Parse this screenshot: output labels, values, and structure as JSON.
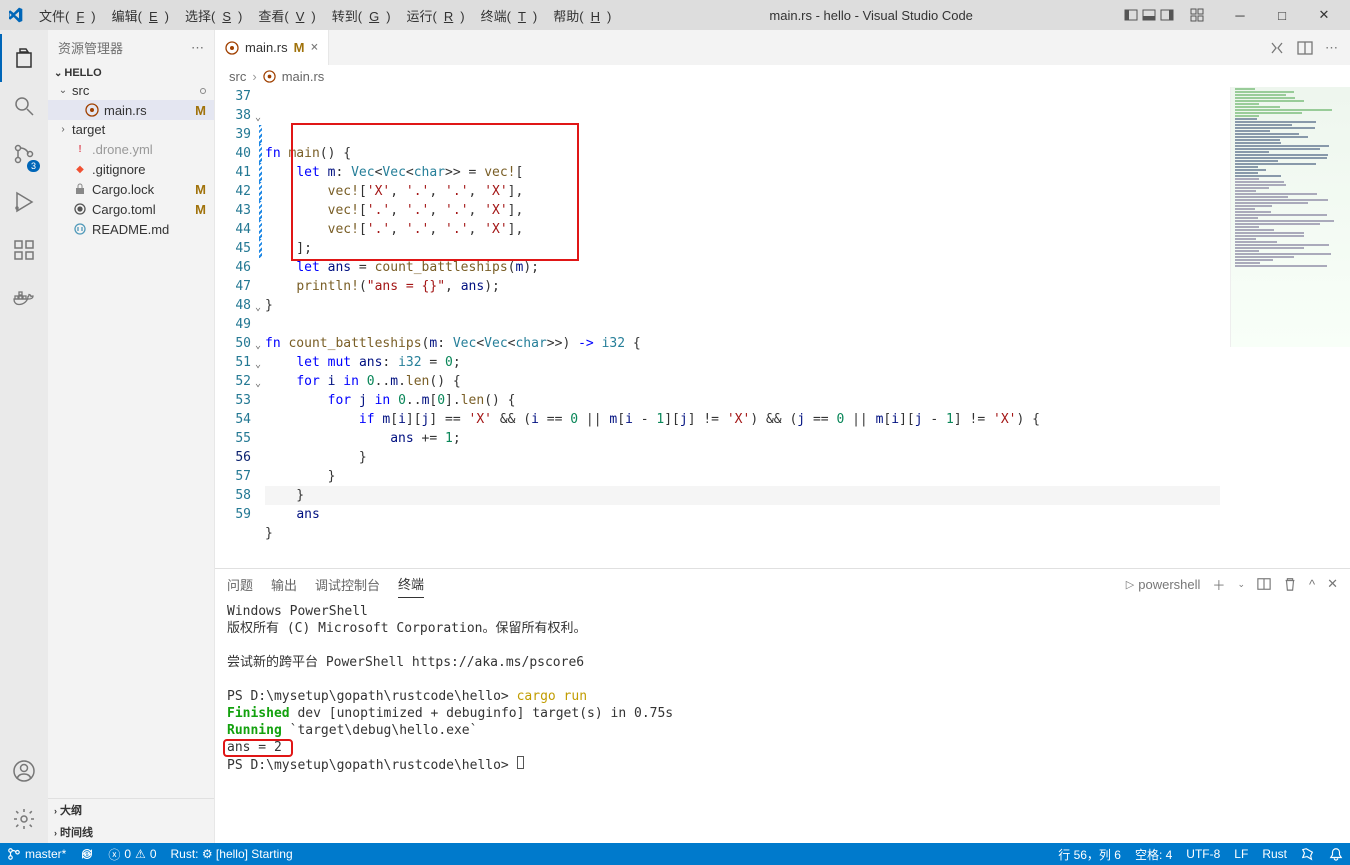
{
  "title": "main.rs - hello - Visual Studio Code",
  "menu": [
    "文件(F)",
    "编辑(E)",
    "选择(S)",
    "查看(V)",
    "转到(G)",
    "运行(R)",
    "终端(T)",
    "帮助(H)"
  ],
  "sidebar": {
    "header": "资源管理器",
    "section": "HELLO",
    "items": [
      {
        "name": "src",
        "kind": "folder",
        "open": true,
        "depth": 0,
        "dirty": true
      },
      {
        "name": "main.rs",
        "kind": "rust",
        "depth": 1,
        "mark": "M",
        "sel": true
      },
      {
        "name": "target",
        "kind": "folder",
        "open": false,
        "depth": 0
      },
      {
        "name": ".drone.yml",
        "kind": "yml",
        "depth": 0,
        "mute": true
      },
      {
        "name": ".gitignore",
        "kind": "git",
        "depth": 0
      },
      {
        "name": "Cargo.lock",
        "kind": "lock",
        "depth": 0,
        "mark": "M"
      },
      {
        "name": "Cargo.toml",
        "kind": "toml",
        "depth": 0,
        "mark": "M"
      },
      {
        "name": "README.md",
        "kind": "md",
        "depth": 0
      }
    ],
    "footer": [
      "大纲",
      "时间线"
    ]
  },
  "tab": {
    "name": "main.rs",
    "mark": "M"
  },
  "breadcrumbs": [
    "src",
    "main.rs"
  ],
  "code": {
    "start": 37,
    "current": 56,
    "lines": [
      {
        "html": ""
      },
      {
        "html": "<span class='k-blue'>fn</span> <span class='k-fn'>main</span>() {",
        "chev": true
      },
      {
        "html": "    <span class='k-blue'>let</span> <span class='k-var'>m</span>: <span class='k-teal'>Vec</span>&lt;<span class='k-teal'>Vec</span>&lt;<span class='k-teal'>char</span>&gt;&gt; = <span class='k-fn'>vec!</span>[",
        "mod": true
      },
      {
        "html": "        <span class='k-fn'>vec!</span>[<span class='k-red'>'X'</span>, <span class='k-red'>'.'</span>, <span class='k-red'>'.'</span>, <span class='k-red'>'X'</span>],",
        "mod": true
      },
      {
        "html": "        <span class='k-fn'>vec!</span>[<span class='k-red'>'.'</span>, <span class='k-red'>'.'</span>, <span class='k-red'>'.'</span>, <span class='k-red'>'X'</span>],",
        "mod": true
      },
      {
        "html": "        <span class='k-fn'>vec!</span>[<span class='k-red'>'.'</span>, <span class='k-red'>'.'</span>, <span class='k-red'>'.'</span>, <span class='k-red'>'X'</span>],",
        "mod": true
      },
      {
        "html": "    ];",
        "mod": true
      },
      {
        "html": "    <span class='k-blue'>let</span> <span class='k-var'>ans</span> = <span class='k-fn'>count_battleships</span>(<span class='k-var'>m</span>);",
        "mod": true
      },
      {
        "html": "    <span class='k-fn'>println!</span>(<span class='k-red'>\"ans = {}\"</span>, <span class='k-var'>ans</span>);",
        "mod": true
      },
      {
        "html": "}"
      },
      {
        "html": ""
      },
      {
        "html": "<span class='k-blue'>fn</span> <span class='k-fn'>count_battleships</span>(<span class='k-var'>m</span>: <span class='k-teal'>Vec</span>&lt;<span class='k-teal'>Vec</span>&lt;<span class='k-teal'>char</span>&gt;&gt;) <span class='k-blue'>-&gt;</span> <span class='k-teal'>i32</span> {",
        "chev": true
      },
      {
        "html": "    <span class='k-blue'>let</span> <span class='k-blue'>mut</span> <span class='k-var'>ans</span>: <span class='k-teal'>i32</span> = <span class='k-num'>0</span>;"
      },
      {
        "html": "    <span class='k-blue'>for</span> <span class='k-var'>i</span> <span class='k-blue'>in</span> <span class='k-num'>0</span>..<span class='k-var'>m</span>.<span class='k-fn'>len</span>() {",
        "chev": true
      },
      {
        "html": "        <span class='k-blue'>for</span> <span class='k-var'>j</span> <span class='k-blue'>in</span> <span class='k-num'>0</span>..<span class='k-var'>m</span>[<span class='k-num'>0</span>].<span class='k-fn'>len</span>() {",
        "chev": true
      },
      {
        "html": "            <span class='k-blue'>if</span> <span class='k-var'>m</span>[<span class='k-var'>i</span>][<span class='k-var'>j</span>] == <span class='k-red'>'X'</span> &amp;&amp; (<span class='k-var'>i</span> == <span class='k-num'>0</span> || <span class='k-var'>m</span>[<span class='k-var'>i</span> - <span class='k-num'>1</span>][<span class='k-var'>j</span>] != <span class='k-red'>'X'</span>) &amp;&amp; (<span class='k-var'>j</span> == <span class='k-num'>0</span> || <span class='k-var'>m</span>[<span class='k-var'>i</span>][<span class='k-var'>j</span> - <span class='k-num'>1</span>] != <span class='k-red'>'X'</span>) {",
        "chev": true
      },
      {
        "html": "                <span class='k-var'>ans</span> += <span class='k-num'>1</span>;"
      },
      {
        "html": "            }"
      },
      {
        "html": "        }"
      },
      {
        "html": "    }",
        "hl": true
      },
      {
        "html": "    <span class='k-var'>ans</span>"
      },
      {
        "html": "}"
      },
      {
        "html": ""
      }
    ]
  },
  "panel": {
    "tabs": [
      "问题",
      "输出",
      "调试控制台",
      "终端"
    ],
    "active": 3,
    "shell": "powershell",
    "lines": [
      "Windows PowerShell",
      "版权所有 (C) Microsoft Corporation。保留所有权利。",
      "",
      "尝试新的跨平台 PowerShell https://aka.ms/pscore6",
      "",
      "PS D:\\mysetup\\gopath\\rustcode\\hello> <span class='y'>cargo run</span>",
      "   <span class='g'>Finished</span> dev [unoptimized + debuginfo] target(s) in 0.75s",
      "    <span class='g'>Running</span> `target\\debug\\hello.exe`",
      "ans = 2",
      "PS D:\\mysetup\\gopath\\rustcode\\hello> <span class='cursor'></span>"
    ]
  },
  "status": {
    "branch": "master*",
    "errors": "0",
    "warnings": "0",
    "rust": "Rust: ⚙ [hello] Starting",
    "pos": "行 56，列 6",
    "spaces": "空格: 4",
    "enc": "UTF-8",
    "eol": "LF",
    "lang": "Rust"
  },
  "scm_badge": "3"
}
